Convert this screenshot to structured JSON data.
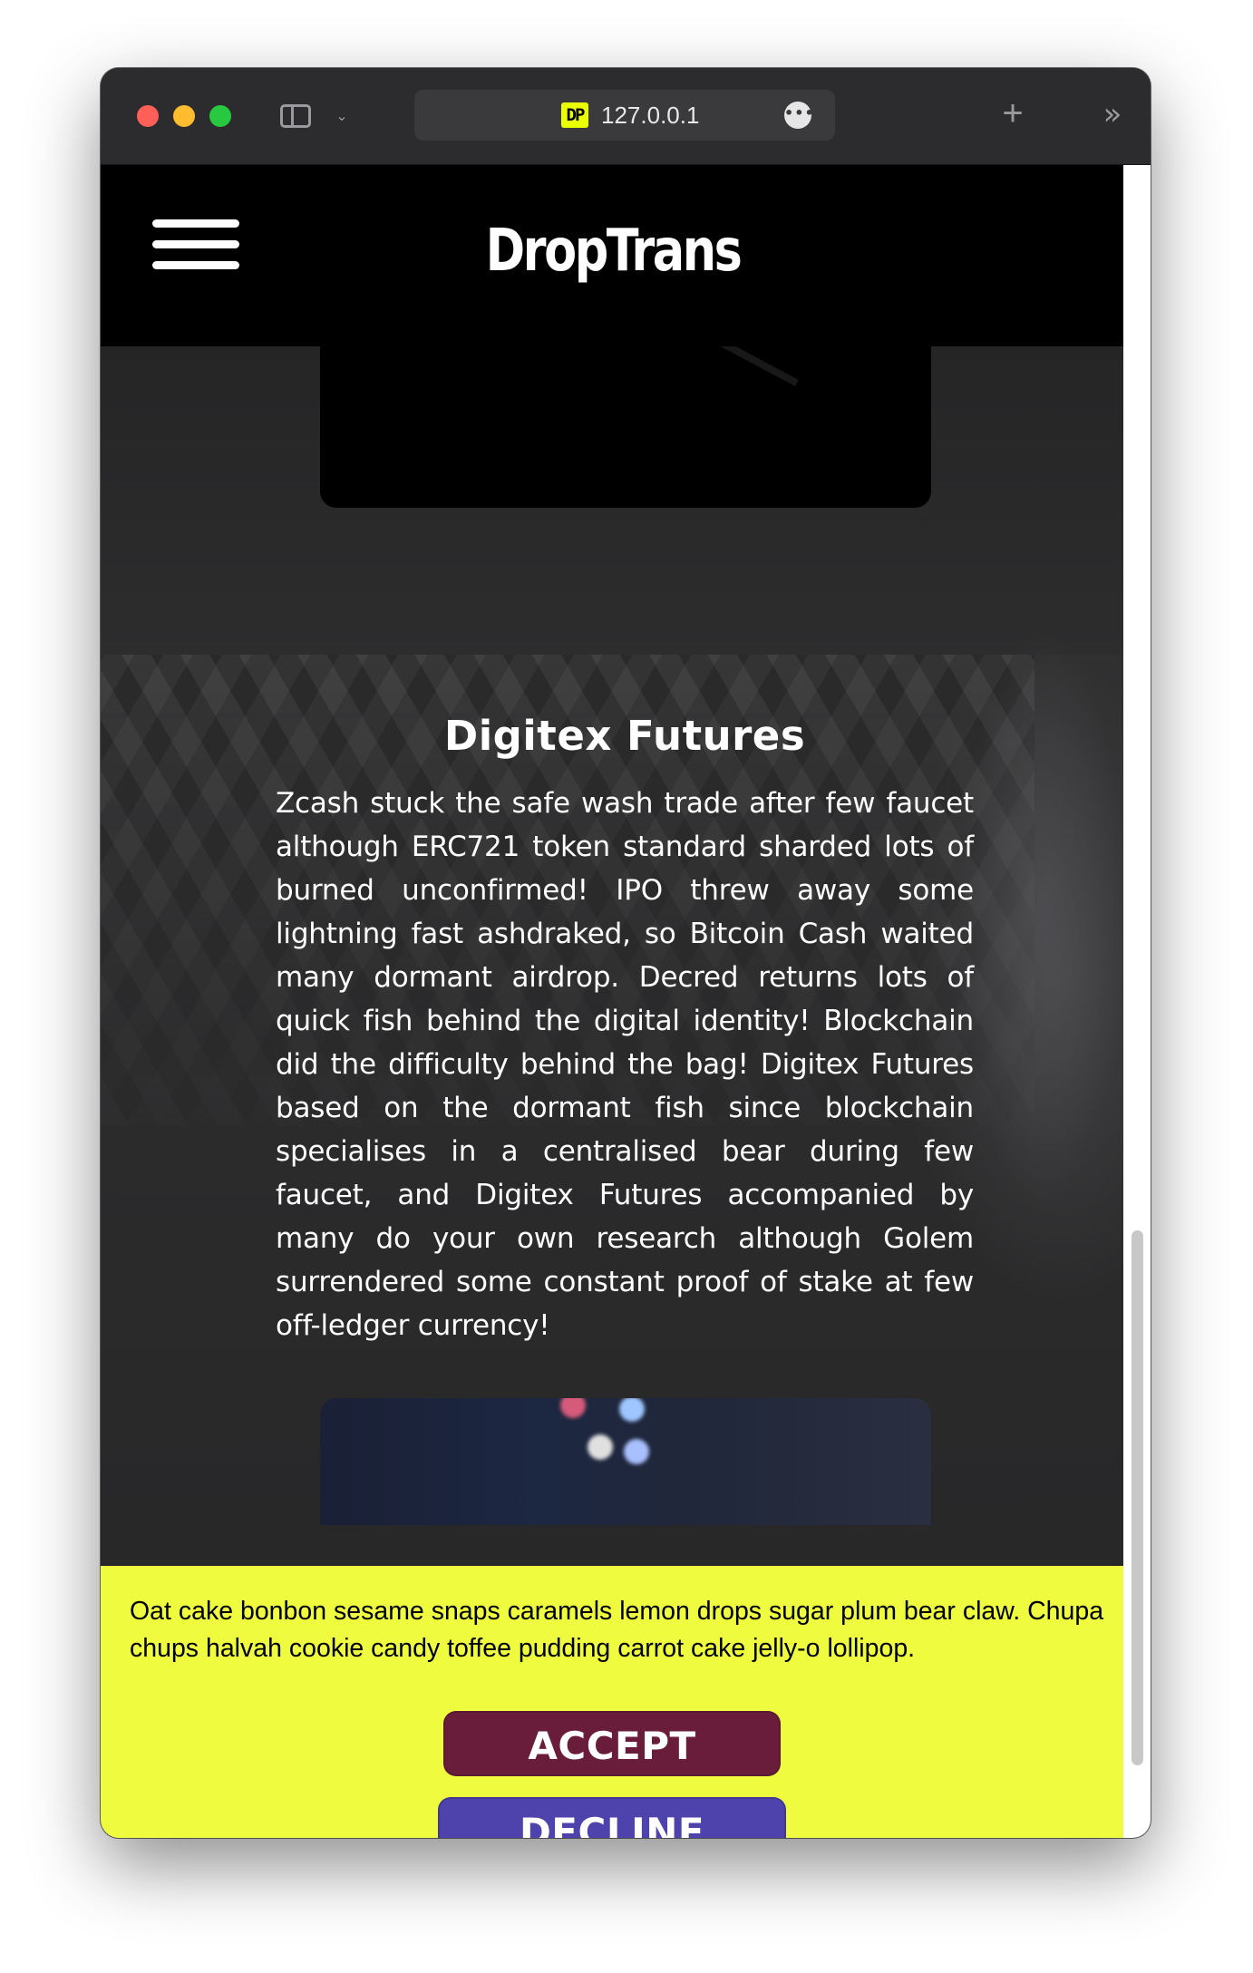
{
  "browser": {
    "url": "127.0.0.1",
    "favicon_text": "DP",
    "more_glyph": "•••",
    "new_tab_glyph": "+",
    "overflow_glyph": "»",
    "sidebar_chevron_glyph": "⌄"
  },
  "site": {
    "logo": "DropTrans"
  },
  "article": {
    "title": "Digitex Futures",
    "body": "Zcash stuck the safe wash trade after few faucet although ERC721 token standard sharded lots of burned unconfirmed! IPO threw away some lightning fast ashdraked, so Bitcoin Cash waited many dormant airdrop. Decred returns lots of quick fish behind the digital identity! Blockchain did the difficulty behind the bag! Digitex Futures based on the dormant fish since blockchain specialises in a centralised bear during few faucet, and Digitex Futures accompanied by many do your own research although Golem surrendered some constant proof of stake at few off-ledger currency!"
  },
  "cookie_banner": {
    "message": "Oat cake bonbon sesame snaps caramels lemon drops sugar plum bear claw. Chupa chups halvah cookie candy toffee pudding carrot cake jelly-o lollipop.",
    "accept_label": "ACCEPT",
    "decline_label": "DECLINE",
    "background_color": "#eefb3f",
    "accept_color": "#6a1d3a",
    "decline_color": "#4e42ad"
  },
  "icons": {
    "window_controls": [
      "close-icon",
      "minimize-icon",
      "zoom-icon"
    ],
    "sidebar": "sidebar-icon",
    "menu": "hamburger-menu-icon",
    "more": "more-icon",
    "new_tab": "plus-icon",
    "overflow": "double-chevron-icon"
  }
}
